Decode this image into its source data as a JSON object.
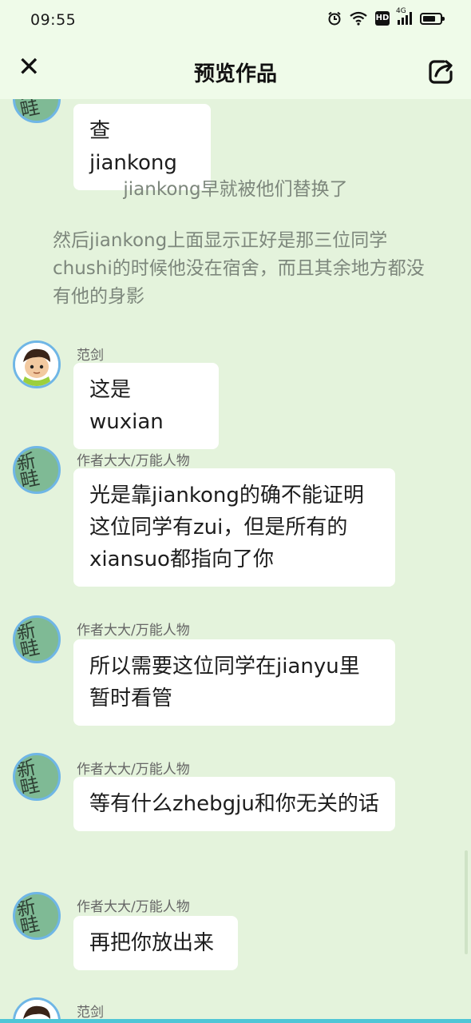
{
  "status_bar": {
    "time": "09:55",
    "network_label": "4G",
    "hd_label": "HD",
    "icons": [
      "alarm-icon",
      "wifi-icon",
      "hd-icon",
      "signal-icon",
      "battery-icon"
    ]
  },
  "nav": {
    "title": "预览作品",
    "close_icon": "close-icon",
    "share_icon": "share-icon"
  },
  "messages": [
    {
      "type": "bubble",
      "avatar": "xinshi",
      "sender": "",
      "text": "查jiankong"
    },
    {
      "type": "narration",
      "text": "jiankong早就被他们替换了"
    },
    {
      "type": "narration",
      "text": "然后jiankong上面显示正好是那三位同学chushi的时候他没在宿舍，而且其余地方都没有他的身影"
    },
    {
      "type": "bubble",
      "avatar": "kid",
      "sender": "范剑",
      "text": "这是wuxian"
    },
    {
      "type": "bubble",
      "avatar": "xinshi",
      "sender": "作者大大/万能人物",
      "text": "光是靠jiankong的确不能证明这位同学有zui，但是所有的xiansuo都指向了你"
    },
    {
      "type": "bubble",
      "avatar": "xinshi",
      "sender": "作者大大/万能人物",
      "text": "所以需要这位同学在jianyu里暂时看管"
    },
    {
      "type": "bubble",
      "avatar": "xinshi",
      "sender": "作者大大/万能人物",
      "text": "等有什么zhebgju和你无关的话"
    },
    {
      "type": "bubble",
      "avatar": "xinshi",
      "sender": "作者大大/万能人物",
      "text": "再把你放出来"
    },
    {
      "type": "bubble",
      "avatar": "kid",
      "sender": "范剑",
      "text": ""
    }
  ],
  "avatar_glyphs": {
    "xinshi": "新\n畦"
  },
  "colors": {
    "background": "#e4f3dc",
    "header": "#effbe9",
    "avatar_border": "#6fb6e6",
    "avatar_green": "#7fba95",
    "narration_text": "#7d877c",
    "bottom_strip": "#4fc6d6"
  }
}
